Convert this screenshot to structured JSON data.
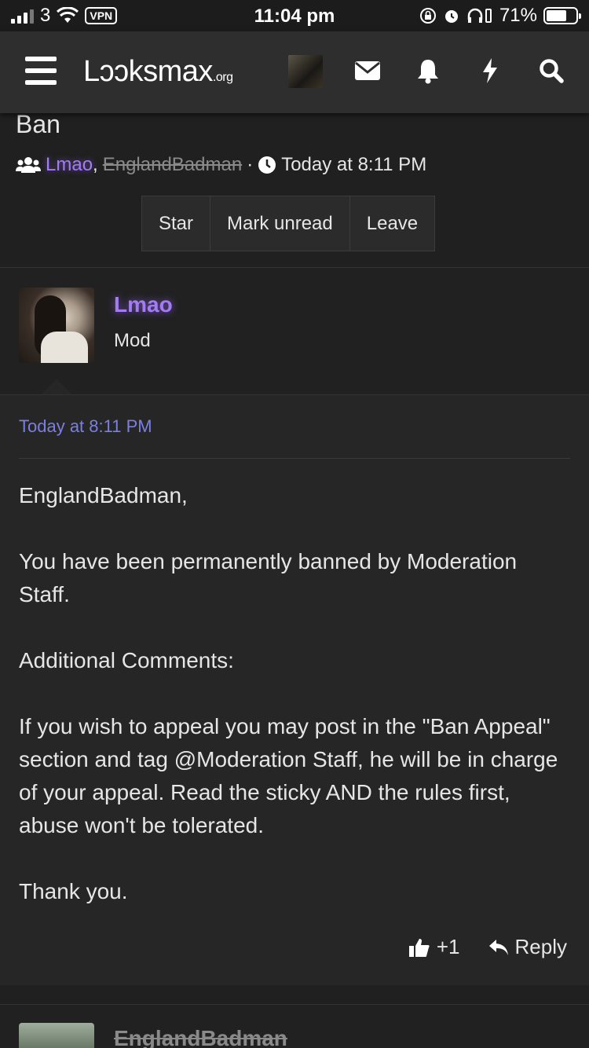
{
  "status_bar": {
    "carrier": "3",
    "vpn": "VPN",
    "time": "11:04 pm",
    "battery": "71%"
  },
  "nav": {
    "logo_main": "Lɔɔksmax",
    "logo_suffix": ".org",
    "icons": [
      "menu-icon",
      "avatar",
      "envelope-icon",
      "bell-icon",
      "lightning-icon",
      "search-icon"
    ]
  },
  "thread": {
    "title": "Ban",
    "participant_1": "Lmao",
    "participant_sep": ",",
    "participant_2": "EnglandBadman",
    "dot": "·",
    "time": "Today at 8:11 PM",
    "actions": {
      "star": "Star",
      "mark_unread": "Mark unread",
      "leave": "Leave"
    }
  },
  "message": {
    "username": "Lmao",
    "role": "Mod",
    "date": "Today at 8:11 PM",
    "paragraphs": [
      "EnglandBadman,",
      "You have been permanently banned by Moderation Staff.",
      "Additional Comments:",
      "If you wish to appeal you may post in the \"Ban Appeal\" section and tag @Moderation Staff, he will be in charge of your appeal. Read the sticky AND the rules first, abuse won't be tolerated.",
      "Thank you."
    ],
    "like_count": "+1",
    "reply_label": "Reply"
  },
  "message2": {
    "username": "EnglandBadman"
  },
  "colors": {
    "accent_purple": "#a27cf0",
    "date_blue": "#7b7fe0",
    "background": "#202020"
  }
}
